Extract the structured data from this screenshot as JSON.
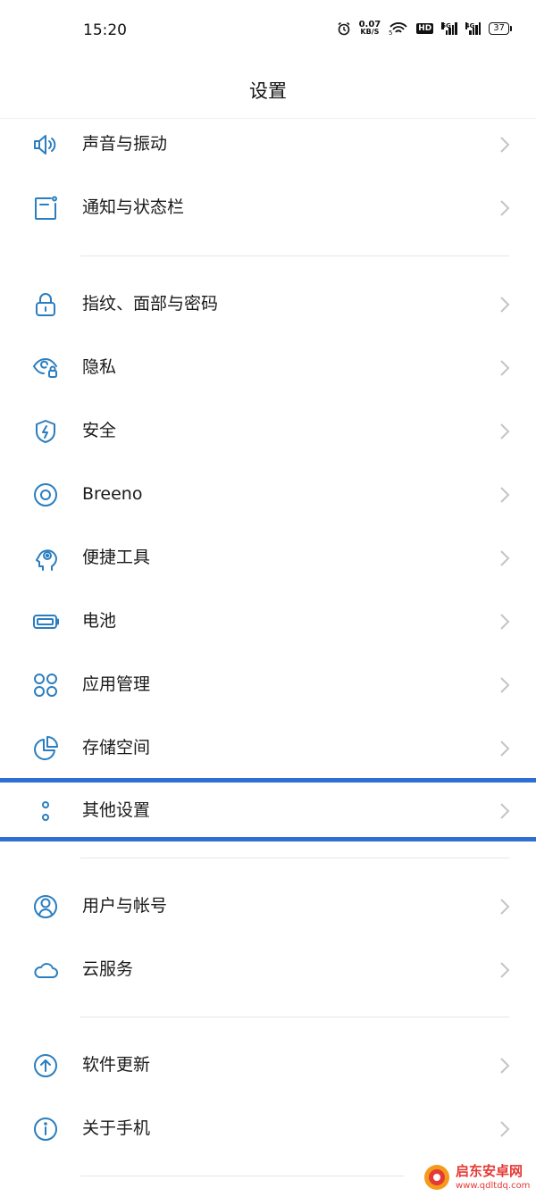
{
  "status": {
    "time": "15:20",
    "speed_value": "0.07",
    "speed_unit": "KB/S",
    "hd": "HD",
    "net1": "5G",
    "net2": "4G",
    "battery": "37"
  },
  "title": "设置",
  "items": [
    {
      "label": "声音与振动",
      "icon": "speaker-icon"
    },
    {
      "label": "通知与状态栏",
      "icon": "notification-icon"
    },
    {
      "label": "指纹、面部与密码",
      "icon": "lock-icon"
    },
    {
      "label": "隐私",
      "icon": "privacy-eye-icon"
    },
    {
      "label": "安全",
      "icon": "shield-icon"
    },
    {
      "label": "Breeno",
      "icon": "breeno-icon"
    },
    {
      "label": "便捷工具",
      "icon": "head-gear-icon"
    },
    {
      "label": "电池",
      "icon": "battery-icon"
    },
    {
      "label": "应用管理",
      "icon": "apps-icon"
    },
    {
      "label": "存储空间",
      "icon": "storage-pie-icon"
    },
    {
      "label": "其他设置",
      "icon": "more-dots-icon"
    },
    {
      "label": "用户与帐号",
      "icon": "user-icon"
    },
    {
      "label": "云服务",
      "icon": "cloud-icon"
    },
    {
      "label": "软件更新",
      "icon": "update-icon"
    },
    {
      "label": "关于手机",
      "icon": "info-icon"
    }
  ],
  "colors": {
    "icon": "#2a7ec0",
    "highlight": "#2f6fd3",
    "chevron": "#c4c4c4"
  },
  "watermark": {
    "title": "启东安卓网",
    "url": "www.qdltdq.com"
  }
}
